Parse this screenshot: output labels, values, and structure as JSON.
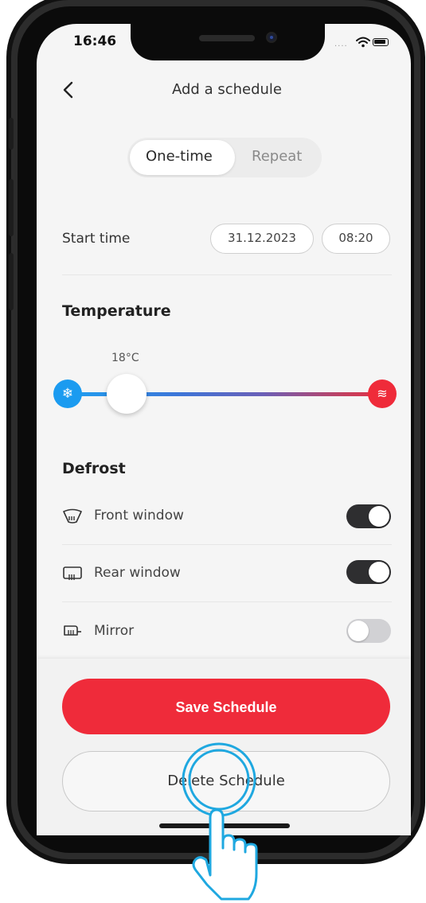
{
  "status_bar": {
    "time": "16:46",
    "signal_dots": "...."
  },
  "header": {
    "title": "Add a schedule"
  },
  "mode_tabs": [
    {
      "label": "One-time",
      "active": true
    },
    {
      "label": "Repeat",
      "active": false
    }
  ],
  "start_time": {
    "label": "Start time",
    "date": "31.12.2023",
    "time": "08:20"
  },
  "temperature": {
    "title": "Temperature",
    "value_label": "18°C",
    "cold_icon": "snowflake-icon",
    "hot_icon": "heat-waves-icon"
  },
  "defrost": {
    "title": "Defrost",
    "items": [
      {
        "label": "Front window",
        "icon": "front-window-defrost-icon",
        "enabled": true
      },
      {
        "label": "Rear window",
        "icon": "rear-window-defrost-icon",
        "enabled": true
      },
      {
        "label": "Mirror",
        "icon": "mirror-defrost-icon",
        "enabled": false
      }
    ]
  },
  "actions": {
    "save_label": "Save Schedule",
    "delete_label": "Delete Schedule"
  },
  "colors": {
    "accent_red": "#ef2b3a",
    "cold_blue": "#1b9bf0",
    "toggle_on": "#2e2e30",
    "tap_hint": "#1fa8e0"
  }
}
